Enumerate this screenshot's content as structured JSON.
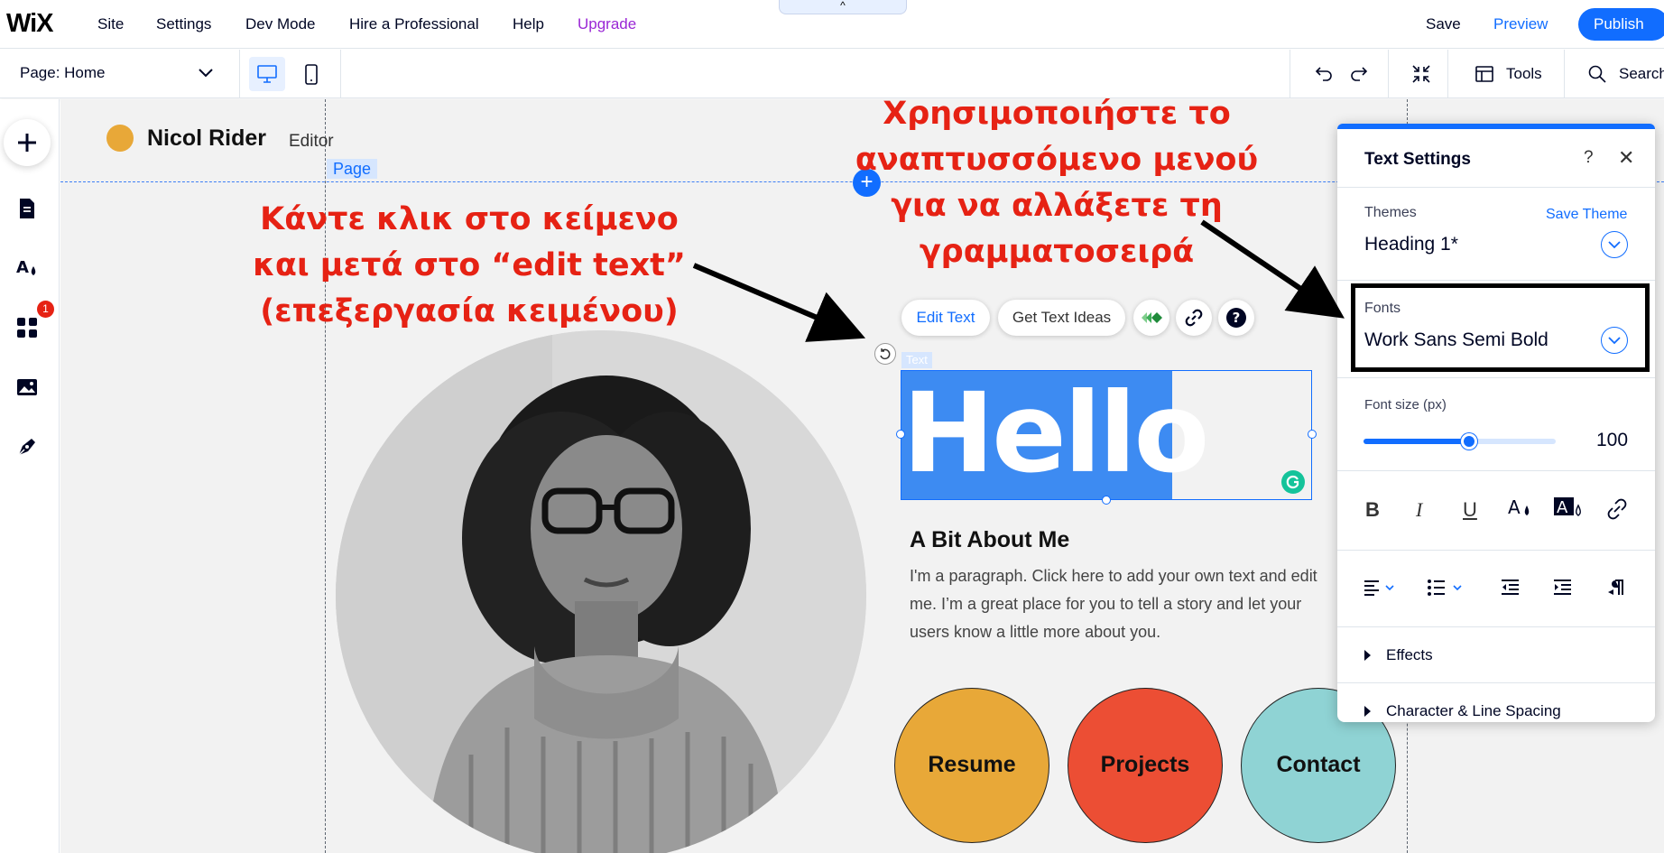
{
  "topbar": {
    "logo": "WiX",
    "menu": [
      "Site",
      "Settings",
      "Dev Mode",
      "Hire a Professional",
      "Help"
    ],
    "upgrade": "Upgrade",
    "collapse_glyph": "^",
    "save": "Save",
    "preview": "Preview",
    "publish": "Publish"
  },
  "subbar": {
    "page_select": "Page: Home",
    "tools": "Tools",
    "search": "Search"
  },
  "leftbar": {
    "apps_badge": "1"
  },
  "canvas": {
    "site_name": "Nicol Rider",
    "site_sub": "Editor",
    "page_tag": "Page",
    "add_section": "+",
    "toolbar": {
      "edit_text": "Edit Text",
      "text_ideas": "Get Text Ideas"
    },
    "text_tag": "Text",
    "heading": "Hello",
    "about_title": "A Bit About Me",
    "about_body": "I'm a paragraph. Click here to add your own text and edit me. I’m a great place for you to tell a story and let your users know a little more about you.",
    "buttons": [
      "Resume",
      "Projects",
      "Contact"
    ]
  },
  "panel": {
    "title": "Text Settings",
    "help": "?",
    "close": "✕",
    "themes_label": "Themes",
    "save_theme": "Save Theme",
    "theme_value": "Heading 1*",
    "fonts_label": "Fonts",
    "font_value": "Work Sans Semi Bold",
    "font_size_label": "Font size (px)",
    "font_size_value": "100",
    "font_size_fraction": 0.55,
    "effects": "Effects",
    "spacing": "Character & Line Spacing"
  },
  "annotations": {
    "left": "Κάντε κλικ στο κείμενο και μετά στο “edit text” (επεξεργασία κειμένου)",
    "right": "Χρησιμοποιήστε το αναπτυσσόμενο μενού για να αλλάξετε τη γραμματοσειρά"
  },
  "colors": {
    "accent": "#116dff",
    "upgrade": "#9a27d5",
    "annotation": "#e62214",
    "resume": "#e8a838",
    "projects": "#ec4e34",
    "contact": "#8fd3d4"
  }
}
